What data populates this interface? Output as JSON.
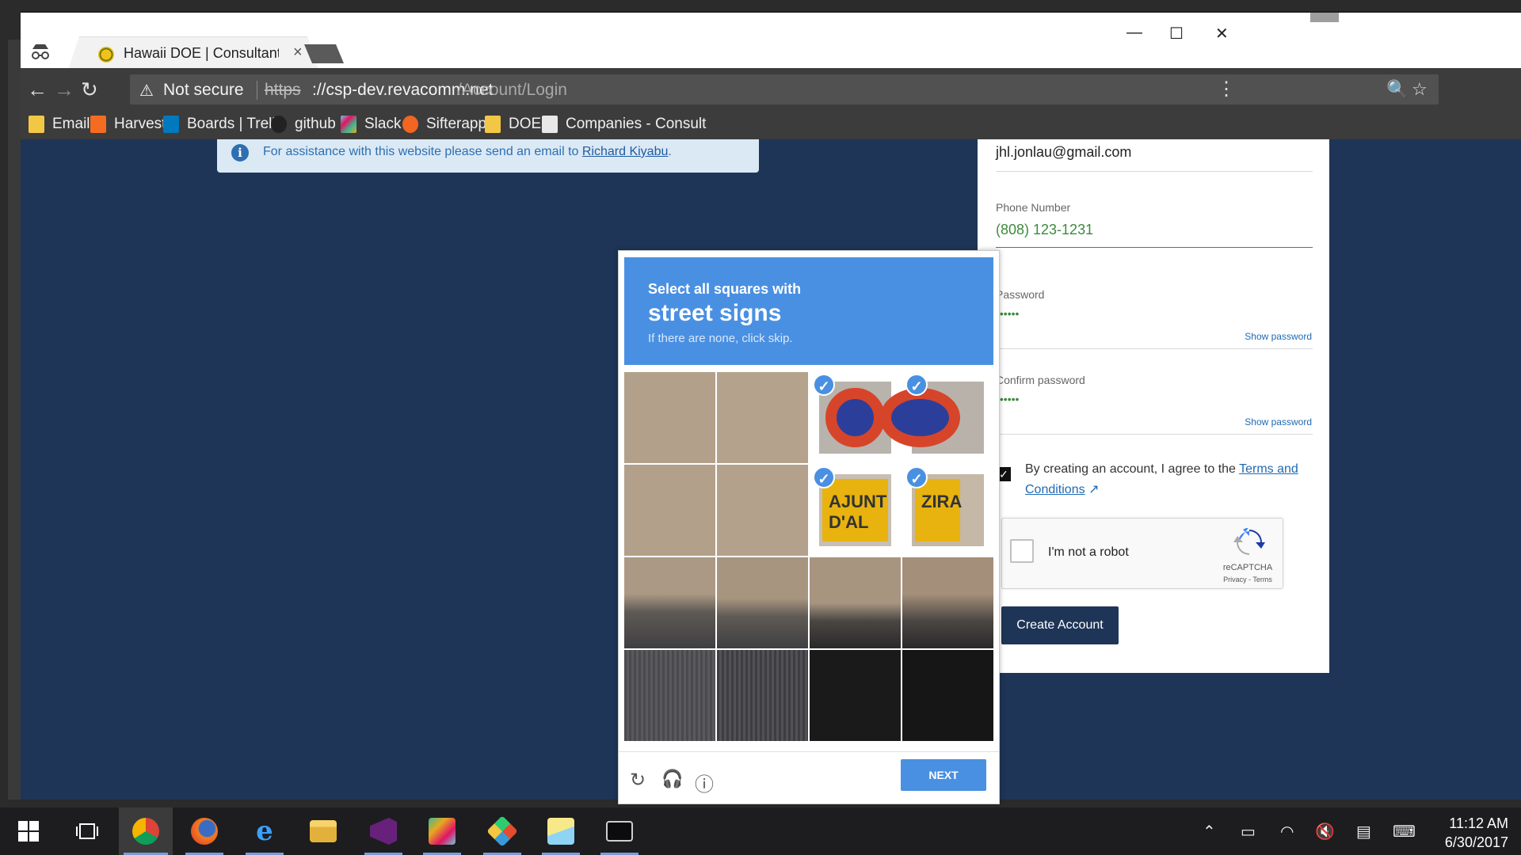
{
  "browser": {
    "tab_title": "Hawaii DOE | Consultant",
    "tab_close": "×",
    "window_controls": {
      "minimize": "—",
      "maximize": "☐",
      "close": "✕"
    },
    "nav": {
      "back": "←",
      "forward": "→",
      "reload": "↻"
    },
    "security_icon": "⚠",
    "security_text": "Not secure",
    "url_scheme": "https",
    "url_host": "://csp-dev.revacomm.net",
    "url_path": "/Account/Login",
    "zoom_icon": "🔍",
    "star_icon": "☆",
    "menu_icon": "⋮"
  },
  "bookmarks": [
    {
      "label": "Email",
      "icon": "folder-icon",
      "color": "#f2c744"
    },
    {
      "label": "Harvest",
      "icon": "harvest-icon",
      "color": "#f36c21"
    },
    {
      "label": "Boards | Trello",
      "icon": "trello-icon",
      "color": "#0079bf"
    },
    {
      "label": "github",
      "icon": "github-icon",
      "color": "#222222"
    },
    {
      "label": "Slack",
      "icon": "slack-icon",
      "color": "#6ecadc"
    },
    {
      "label": "Sifterapp",
      "icon": "sifter-icon",
      "color": "#f26522"
    },
    {
      "label": "DOE",
      "icon": "folder-icon",
      "color": "#f2c744"
    },
    {
      "label": "Companies - Consult",
      "icon": "doc-icon",
      "color": "#e8e8e8"
    }
  ],
  "notice": {
    "icon": "i",
    "text": "For assistance with this website please send an email to ",
    "link": "Richard Kiyabu",
    "suffix": "."
  },
  "form": {
    "email_value": "jhl.jonlau@gmail.com",
    "phone_label": "Phone Number",
    "phone_value": "(808) 123-1231",
    "password_label": "Password",
    "password_value": "••••••",
    "show_password": "Show password",
    "confirm_label": "Confirm password",
    "confirm_value": "••••••",
    "show_confirm": "Show password",
    "agree_check": "✓",
    "agree_text": "By creating an account, I agree to the ",
    "terms_link": "Terms and Conditions",
    "terms_icon": "↗",
    "recaptcha_label": "I'm not a robot",
    "recaptcha_brand": "reCAPTCHA",
    "recaptcha_links": "Privacy - Terms",
    "create_button": "Create Account",
    "accent_color": "#3d8b3d"
  },
  "challenge": {
    "line1": "Select all squares with",
    "line2": "street signs",
    "line3": "If there are none, click skip.",
    "selected_cells": [
      2,
      3,
      6,
      7
    ],
    "check_mark": "✓",
    "reload_icon": "↻",
    "audio_icon": "🎧",
    "info_icon": "ⓘ",
    "next_button": "NEXT",
    "header_color": "#4a90e2",
    "sign_text_left": "AJUNT D'AL",
    "sign_text_right": "ZIRA"
  },
  "taskbar": {
    "start_icon": "windows-icon",
    "apps": [
      "task-view-icon",
      "chrome-icon",
      "firefox-icon",
      "edge-icon",
      "file-explorer-icon",
      "visual-studio-icon",
      "slack-icon",
      "git-icon",
      "sticky-notes-icon",
      "terminal-icon"
    ],
    "active_app": "chrome-icon",
    "time": "11:12 AM",
    "date": "6/30/2017"
  }
}
